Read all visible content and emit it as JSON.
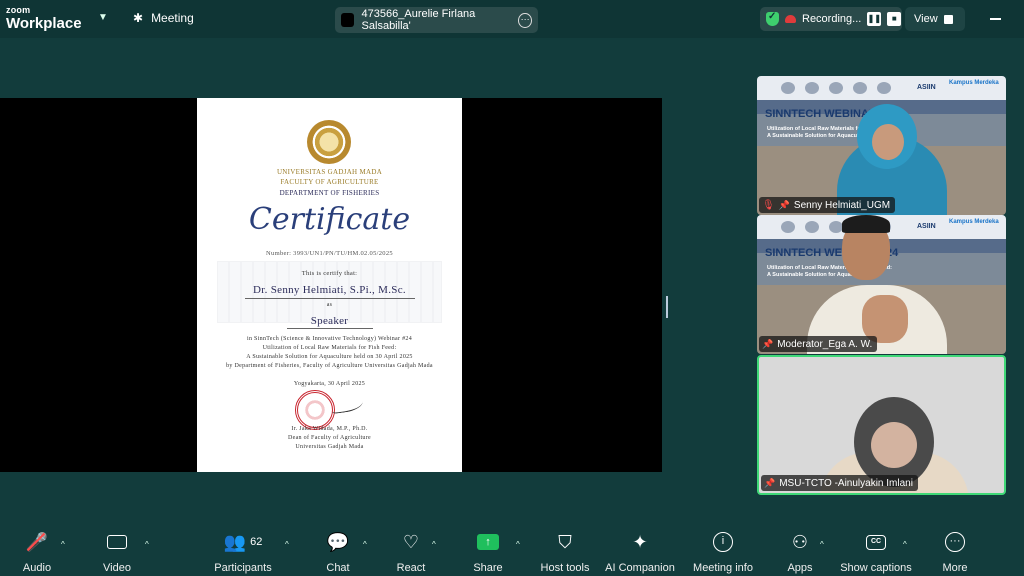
{
  "topbar": {
    "brand_small": "zoom",
    "brand_big": "Workplace",
    "meeting_label": "Meeting",
    "meeting_title": "473566_Aurelie Firlana Salsabilla'",
    "recording_label": "Recording...",
    "view_label": "View"
  },
  "certificate": {
    "university": "UNIVERSITAS GADJAH MADA",
    "faculty": "FACULTY OF AGRICULTURE",
    "department": "DEPARTMENT OF FISHERIES",
    "heading": "Certificate",
    "number": "Number: 3993/UN1/PN/TU/HM.02.05/2025",
    "certify_text": "This is certify that:",
    "recipient": "Dr. Senny Helmiati, S.Pi., M.Sc.",
    "as_text": "as",
    "role": "Speaker",
    "body_line1": "in SinnTech (Science & Innovative Technology) Webinar #24",
    "body_line2": "Utilization of Local Raw Materials for Fish Feed:",
    "body_line3": "A Sustainable Solution for Aquaculture held on 30 April 2025",
    "body_line4": "by Department of Fisheries, Faculty of Agriculture Universitas Gadjah Mada",
    "place_date": "Yogyakarta, 30 April 2025",
    "signer": "Ir. Jaka Widada, M.P., Ph.D.",
    "signer_title": "Dean of Faculty of Agriculture",
    "signer_org": "Universitas Gadjah Mada"
  },
  "banner": {
    "headline": "SINNTECH WEBINAR #24",
    "sub1": "Utilization of Local Raw Materials for Fish Feed:",
    "sub2": "A Sustainable Solution for Aquaculture",
    "asiin": "ASIIN",
    "kampus": "Kampus Merdeka"
  },
  "participants": [
    {
      "name": "Senny Helmiati_UGM",
      "muted": true
    },
    {
      "name": "Moderator_Ega A. W.",
      "muted": false
    },
    {
      "name": "MSU-TCTO -Ainulyakin Imlani",
      "muted": false
    }
  ],
  "toolbar": {
    "audio": "Audio",
    "video": "Video",
    "participants": "Participants",
    "participants_count": "62",
    "chat": "Chat",
    "react": "React",
    "share": "Share",
    "host_tools": "Host tools",
    "ai_companion": "AI Companion",
    "meeting_info": "Meeting info",
    "apps": "Apps",
    "show_captions": "Show captions",
    "more": "More"
  },
  "colors": {
    "background": "#123c3c",
    "share_green": "#1fbf5d",
    "active_speaker_border": "#3fd877",
    "recording_red": "#e03b3b"
  },
  "icons": [
    "mic-off-icon",
    "video-camera-icon",
    "participants-icon",
    "chat-icon",
    "heart-icon",
    "share-arrow-icon",
    "shield-icon",
    "sparkle-icon",
    "info-icon",
    "apps-icon",
    "captions-icon",
    "more-icon"
  ]
}
